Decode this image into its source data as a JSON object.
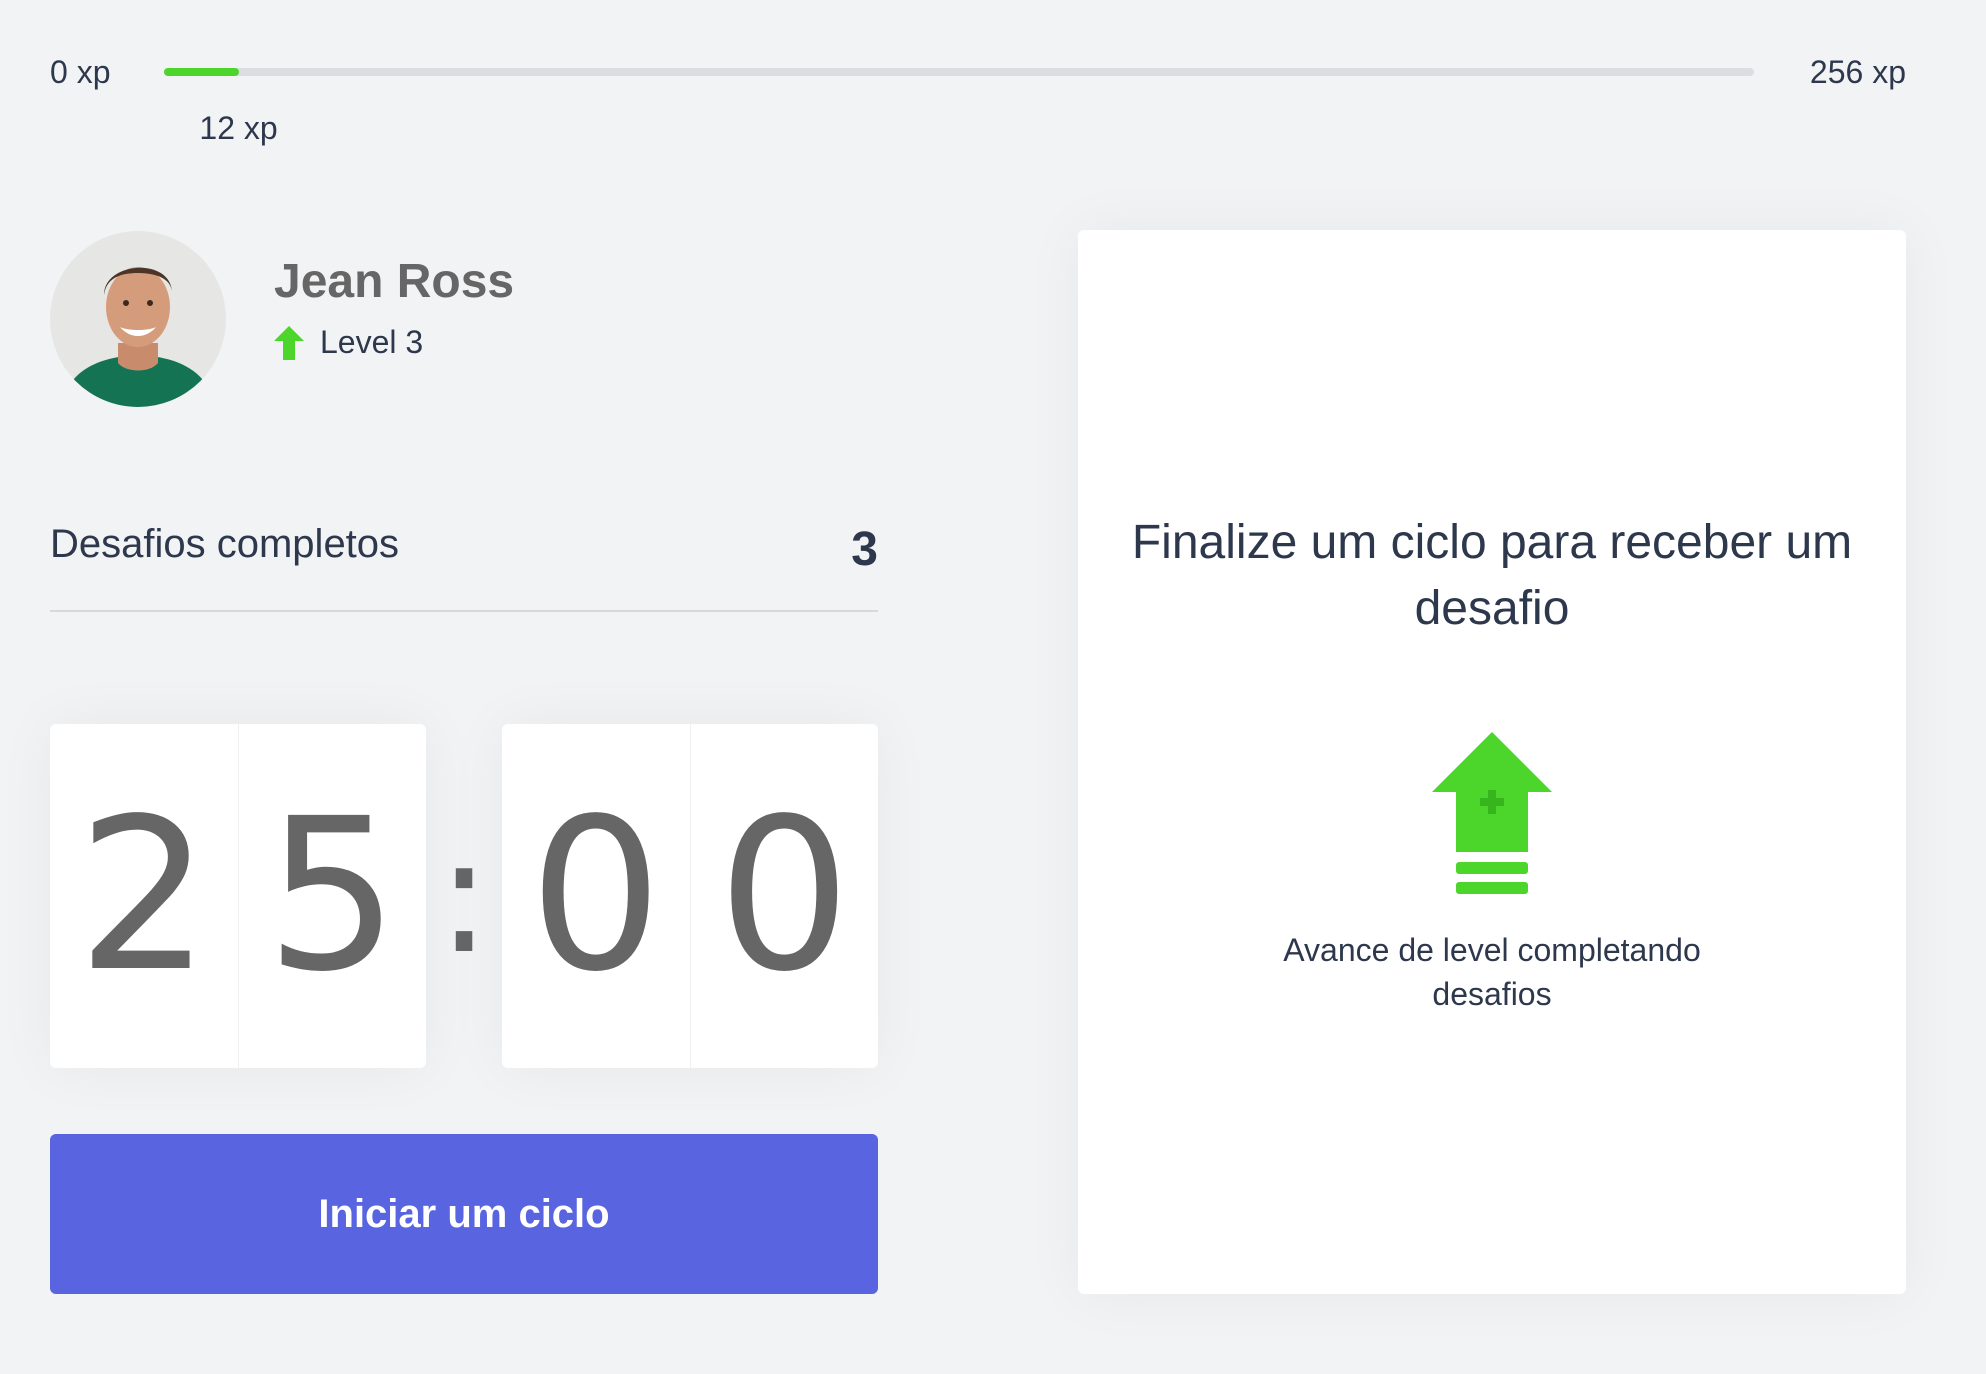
{
  "xp": {
    "min_label": "0 xp",
    "max_label": "256 xp",
    "current_label": "12 xp",
    "current": 12,
    "max": 256,
    "fill_color": "#4CD62B"
  },
  "profile": {
    "name": "Jean Ross",
    "level_label": "Level 3",
    "level_icon": "level-up-arrow-icon"
  },
  "challenges": {
    "label": "Desafios completos",
    "count": "3"
  },
  "countdown": {
    "minute_left": "2",
    "minute_right": "5",
    "separator": ":",
    "second_left": "0",
    "second_right": "0"
  },
  "actions": {
    "start_label": "Iniciar um ciclo",
    "button_color": "#5965E0"
  },
  "challenge_box": {
    "title": "Finalize um ciclo para receber um desafio",
    "icon": "level-up-icon",
    "hint": "Avance de level completando desafios"
  }
}
